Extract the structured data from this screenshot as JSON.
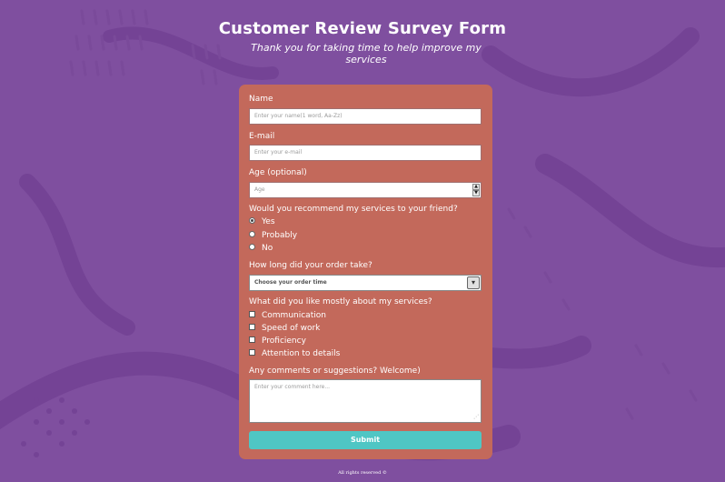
{
  "header": {
    "title": "Customer Review Survey Form",
    "subtitle": "Thank you for taking time to help improve my services"
  },
  "form": {
    "name": {
      "label": "Name",
      "placeholder": "Enter your name(1 word, Aa-Zz)"
    },
    "email": {
      "label": "E-mail",
      "placeholder": "Enter your e-mail"
    },
    "age": {
      "label": "Age (optional)",
      "placeholder": "Age"
    },
    "recommend": {
      "label": "Would you recommend my services to your friend?",
      "options": [
        "Yes",
        "Probably",
        "No"
      ],
      "selected": "Yes"
    },
    "order_time": {
      "label": "How long did your order take?",
      "selected": "Choose your order time"
    },
    "liked": {
      "label": "What did you like mostly about my services?",
      "options": [
        "Communication",
        "Speed of work",
        "Proficiency",
        "Attention to details"
      ]
    },
    "comments": {
      "label": "Any comments or suggestions? Welcome)",
      "placeholder": "Enter your comment here..."
    },
    "submit_label": "Submit"
  },
  "footer": {
    "text": "All rights reserved ©"
  },
  "colors": {
    "background": "#7f4f9f",
    "form_background": "#c3695b",
    "submit_button": "#4fc6c4"
  },
  "icons": {
    "spinner": "number-spinner-icon",
    "select": "chevron-down-icon",
    "textarea_grip": "resize-grip-icon"
  }
}
